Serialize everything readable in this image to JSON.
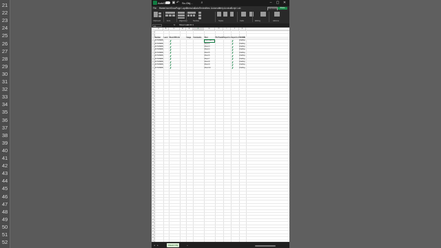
{
  "background": {
    "row_numbers": [
      "21",
      "22",
      "23",
      "24",
      "25",
      "26",
      "27",
      "28",
      "29",
      "30",
      "31",
      "32",
      "33",
      "34",
      "35",
      "36",
      "37",
      "38",
      "39",
      "40",
      "41",
      "42",
      "43",
      "44",
      "45",
      "46",
      "47",
      "48",
      "49",
      "50",
      "51",
      "52"
    ]
  },
  "titlebar": {
    "autosave_label": "AutoSave",
    "file_name": "Sc-Obj...",
    "search_icon": "search-icon"
  },
  "menu": {
    "items": [
      "File",
      "Home",
      "Insert",
      "Draw",
      "Page Layout",
      "Formulas",
      "Data",
      "Review",
      "View",
      "Automate",
      "Help",
      "Acrobat",
      "Script Lab"
    ],
    "active": "Home",
    "comments_label": "Comments",
    "share_label": "Share"
  },
  "ribbon": {
    "groups": [
      "Clipboard",
      "Font",
      "Alignment",
      "Number",
      "Styles",
      "Cells",
      "Editing",
      "Add-ins"
    ]
  },
  "formula_bar": {
    "name_box": "F2",
    "fx": "fx",
    "content": "Shoot walk ID 1"
  },
  "sheet": {
    "columns": [
      "A",
      "B",
      "C",
      "D",
      "E",
      "F",
      "G",
      "H",
      "I",
      "J",
      "K"
    ],
    "headers": [
      "Number",
      "Level",
      "Shoot RDA Hourly Elevation",
      "Image",
      "Comments",
      "Shot",
      "PG Predefined Type",
      "Export to PD ..",
      "Export to PD",
      "DESIRE"
    ],
    "rows": [
      {
        "a": "AC7109999 - 0",
        "b": "",
        "f": "Shoot walk ID 1",
        "k": "Drafting"
      },
      {
        "a": "AC7109999 - 1",
        "b": "",
        "f": "Shoot 2",
        "k": "Drafting"
      },
      {
        "a": "AC7109999 - 2",
        "b": "",
        "f": "Shoot 3",
        "k": "Drafting"
      },
      {
        "a": "AC7109999 - 3",
        "b": "",
        "f": "Shoot 4",
        "k": "Drafting"
      },
      {
        "a": "AC7109999 - 4",
        "b": "",
        "f": "Shoot 5",
        "k": "Drafting"
      },
      {
        "a": "AC7109999 - 5",
        "b": "",
        "f": "Shoot 6",
        "k": "Drafting"
      },
      {
        "a": "AC7109999 - 6",
        "b": "",
        "f": "Shoot 7",
        "k": "Drafting"
      },
      {
        "a": "AC7109999 - 7",
        "b": "",
        "f": "Shoot 8",
        "k": "Drafting"
      },
      {
        "a": "AC7109999 - 8",
        "b": "",
        "f": "Shoot 9",
        "k": "Drafting"
      },
      {
        "a": "AC7109999 - 9",
        "b": "",
        "f": "Shoot 10",
        "k": "Drafting"
      }
    ],
    "row_header_start": 1,
    "tab_name": "Sheet1 Obj"
  },
  "colors": {
    "accent": "#107c41",
    "share": "#1e8a4c",
    "check": "#2e8b57"
  }
}
